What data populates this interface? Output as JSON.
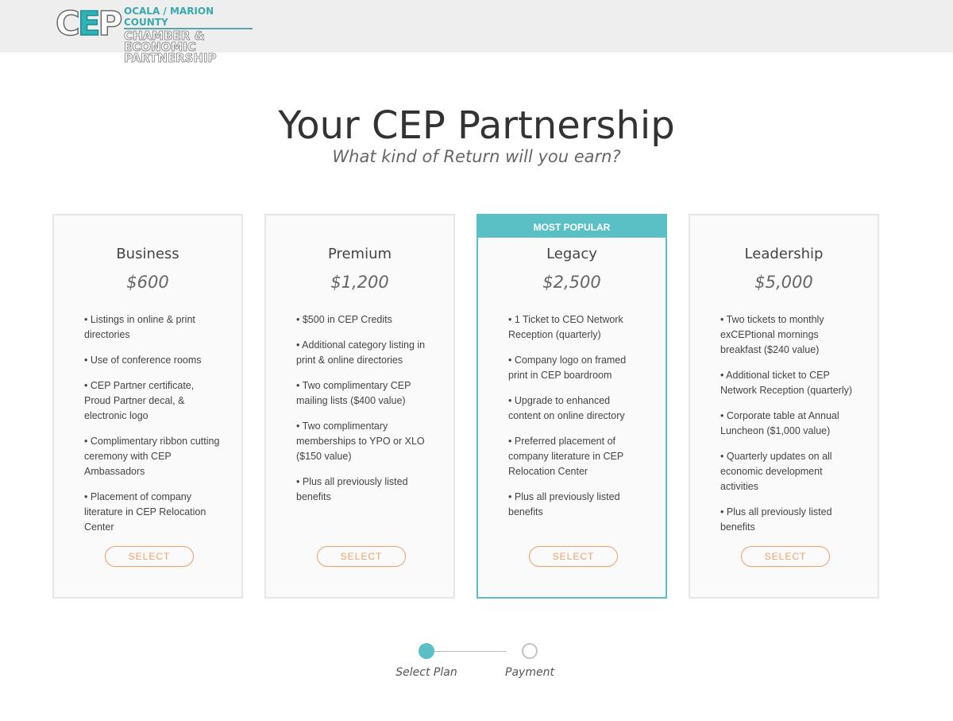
{
  "header": {
    "logo_mark": "CEP",
    "logo_line1": "Ocala / Marion County",
    "logo_line2": "Chamber & Economic",
    "logo_line3": "Partnership"
  },
  "main": {
    "title": "Your CEP Partnership",
    "subtitle": "What kind of Return will you earn?"
  },
  "plans": [
    {
      "name": "Business",
      "price": "$600",
      "ribbon": "",
      "features": [
        "Listings in online & print directories",
        "Use of conference rooms",
        "CEP Partner certificate, Proud Partner decal, & electronic logo",
        "Complimentary ribbon cutting ceremony with CEP Ambassadors",
        "Placement of company literature in CEP Relocation Center"
      ],
      "button": "Select"
    },
    {
      "name": "Premium",
      "price": "$1,200",
      "ribbon": "",
      "features": [
        "$500 in CEP Credits",
        "Additional category listing in print & online directories",
        "Two complimentary CEP mailing lists ($400 value)",
        "Two complimentary memberships to YPO or XLO ($150 value)",
        "Plus all previously listed benefits"
      ],
      "button": "Select"
    },
    {
      "name": "Legacy",
      "price": "$2,500",
      "ribbon": "Most Popular",
      "features": [
        "1 Ticket to CEO Network Reception (quarterly)",
        "Company logo on framed print in CEP boardroom",
        "Upgrade to enhanced content on online directory",
        "Preferred placement of company literature in CEP Relocation Center",
        "Plus all previously listed benefits"
      ],
      "button": "Select"
    },
    {
      "name": "Leadership",
      "price": "$5,000",
      "ribbon": "",
      "features": [
        "Two tickets to monthly exCEPtional mornings breakfast ($240 value)",
        "Additional ticket to CEP Network Reception (quarterly)",
        "Corporate table at Annual Luncheon ($1,000 value)",
        "Quarterly updates on all economic development activities",
        "Plus all previously listed benefits"
      ],
      "button": "Select"
    }
  ],
  "steps": [
    {
      "label": "Select Plan",
      "active": true
    },
    {
      "label": "Payment",
      "active": false
    }
  ],
  "colors": {
    "accent": "#5bc0c6",
    "button": "#f0a067",
    "header_bg": "#eeeeee"
  }
}
